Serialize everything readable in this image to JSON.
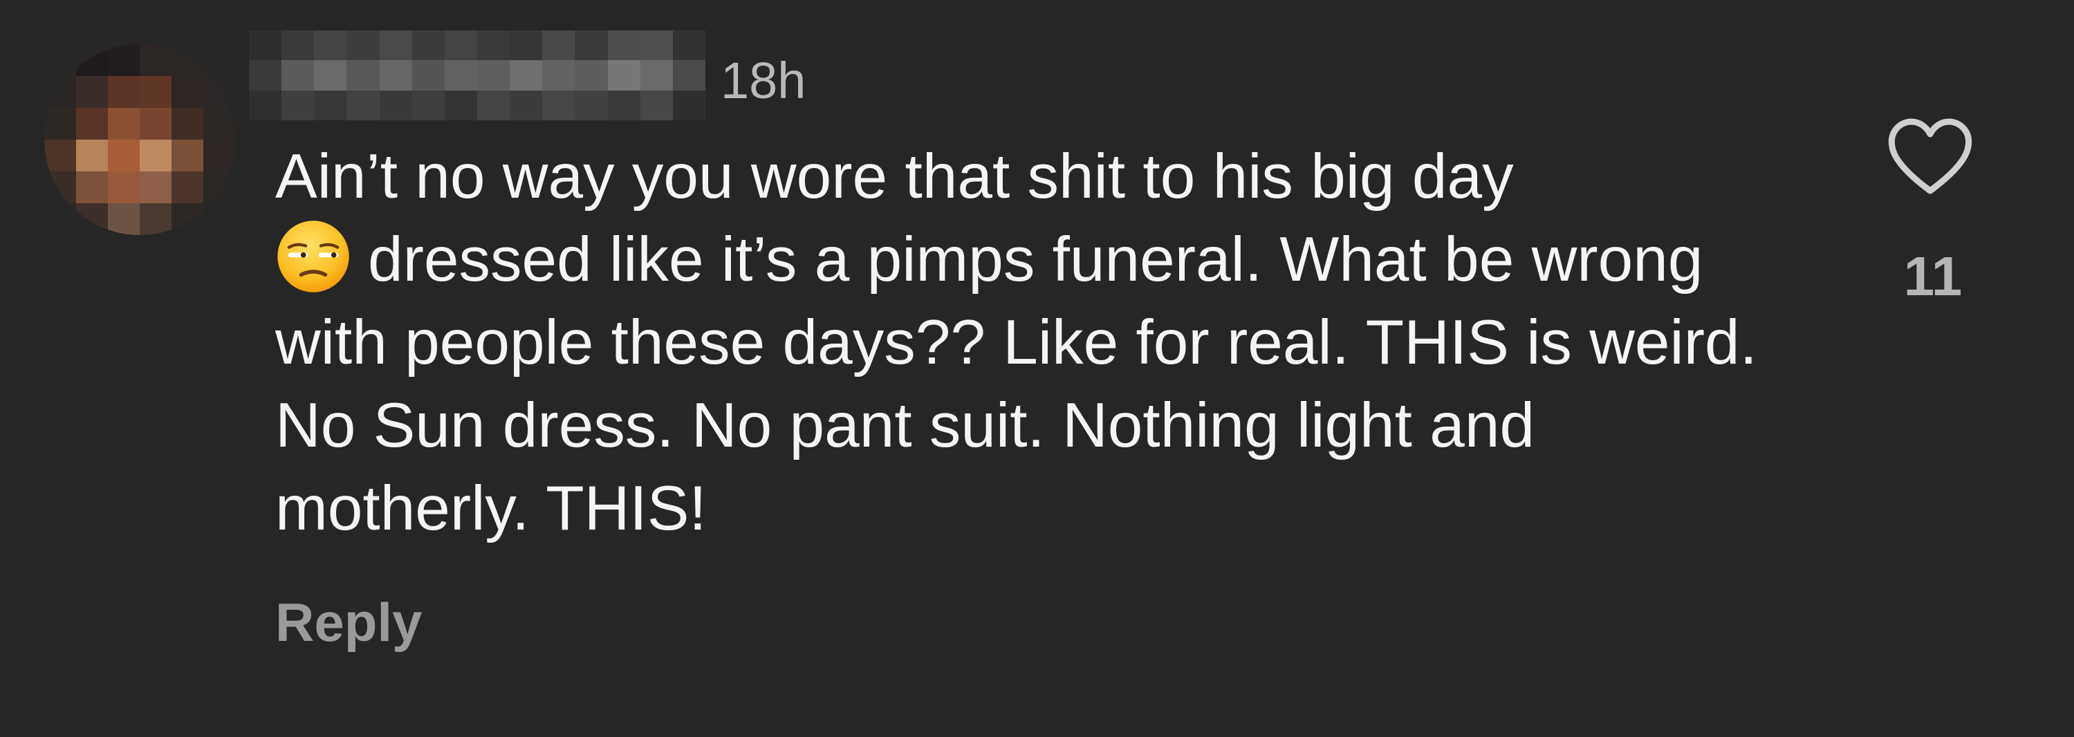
{
  "comment": {
    "timestamp": "18h",
    "text_line_1": "Ain’t no way you wore that shit to his big day",
    "text_after_emoji": "dressed like it’s a pimps funeral. What be wrong with people these days?? Like for real. THIS is weird. No Sun dress. No pant suit. Nothing light and motherly. THIS!",
    "emoji_icon": "unamused-face-icon",
    "reply_label": "Reply",
    "like_icon": "heart-outline-icon",
    "like_count": "11"
  },
  "colors": {
    "background": "#262626",
    "primary_text": "#f5f5f5",
    "secondary_text": "#b9b9b9",
    "muted_text": "#9a9a9a"
  }
}
